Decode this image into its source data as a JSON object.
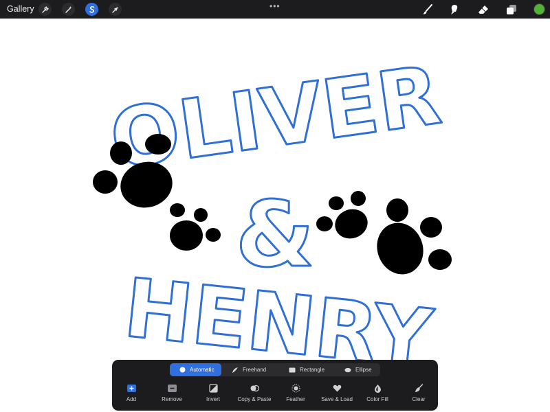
{
  "topbar": {
    "gallery_label": "Gallery",
    "left_tools": [
      {
        "icon": "wrench-icon",
        "active": false
      },
      {
        "icon": "magic-wand-icon",
        "active": false
      },
      {
        "icon": "selection-icon",
        "active": true
      },
      {
        "icon": "arrow-cursor-icon",
        "active": false
      }
    ],
    "center_handle": "•••",
    "right_tools": [
      "brush-icon",
      "smudge-icon",
      "eraser-icon",
      "layers-icon"
    ],
    "current_color": "#52b236"
  },
  "canvas": {
    "artwork_text": [
      "OLIVER",
      "&",
      "HENRY"
    ],
    "stroke_color": "#2f6fd6"
  },
  "selection_panel": {
    "modes": [
      {
        "label": "Automatic",
        "icon": "circle-icon",
        "active": true
      },
      {
        "label": "Freehand",
        "icon": "freehand-icon",
        "active": false
      },
      {
        "label": "Rectangle",
        "icon": "rectangle-icon",
        "active": false
      },
      {
        "label": "Ellipse",
        "icon": "ellipse-icon",
        "active": false
      }
    ],
    "actions": [
      {
        "label": "Add",
        "icon": "add-icon"
      },
      {
        "label": "Remove",
        "icon": "remove-icon"
      },
      {
        "label": "Invert",
        "icon": "invert-icon"
      },
      {
        "label": "Copy & Paste",
        "icon": "copy-paste-icon"
      },
      {
        "label": "Feather",
        "icon": "feather-icon"
      },
      {
        "label": "Save & Load",
        "icon": "heart-icon"
      },
      {
        "label": "Color Fill",
        "icon": "color-fill-icon"
      },
      {
        "label": "Clear",
        "icon": "broom-icon"
      }
    ]
  },
  "colors": {
    "accent": "#2f6fe0",
    "topbar_bg": "#1c1c1e",
    "panel_bg": "#1c1c1e"
  }
}
